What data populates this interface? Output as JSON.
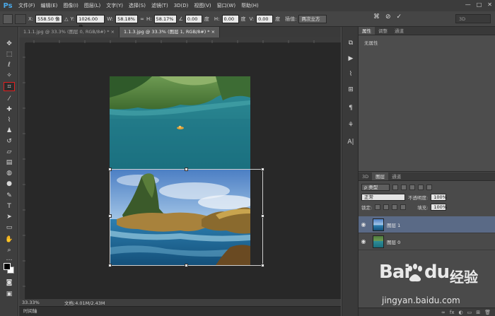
{
  "app": {
    "logo": "Ps",
    "menus": [
      "文件(F)",
      "编辑(E)",
      "图像(I)",
      "图层(L)",
      "文字(Y)",
      "选择(S)",
      "滤镜(T)",
      "3D(D)",
      "视图(V)",
      "窗口(W)",
      "帮助(H)"
    ],
    "window_controls": [
      "—",
      "□",
      "✕"
    ]
  },
  "options": {
    "x_label": "X:",
    "x_value": "558.50 像",
    "y_label": "Y:",
    "y_value": "1026.00 像",
    "w_label": "W:",
    "w_value": "58.18%",
    "h_label": "H:",
    "h_value": "58.17%",
    "angle_value": "0.00",
    "angle_unit": "度",
    "hskew_label": "H:",
    "hskew_value": "0.00",
    "hskew_unit": "度",
    "vskew_label": "V:",
    "vskew_value": "0.00",
    "vskew_unit": "度",
    "interp_label": "插值:",
    "interp_value": "两次立方",
    "workspace": "3D"
  },
  "tabs": [
    {
      "label": "1.1.1.jpg @ 33.3% (图层 0, RGB/8#) *  ×",
      "active": false
    },
    {
      "label": "1.1.3.jpg @ 33.3% (图层 1, RGB/8#) *  ×",
      "active": true
    }
  ],
  "status": {
    "zoom": "33.33%",
    "doc": "文档:4.01M/2.43M",
    "timeline": "时间轴"
  },
  "panels": {
    "props_tabs": [
      "属性",
      "调整",
      "通道"
    ],
    "props_text": "无属性",
    "layer_tabs": [
      "3D",
      "图层",
      "通道"
    ],
    "filter_kind": "ρ 类型",
    "blend_mode": "正常",
    "opacity_label": "不透明度:",
    "opacity_value": "100%",
    "lock_label": "锁定:",
    "fill_label": "填充:",
    "fill_value": "100%",
    "layers": [
      {
        "name": "图层 1",
        "active": true
      },
      {
        "name": "图层 0",
        "active": false
      }
    ]
  },
  "watermark": {
    "brand": "Bai",
    "brand2": "du",
    "jingyan": "经验",
    "url": "jingyan.baidu.com"
  }
}
